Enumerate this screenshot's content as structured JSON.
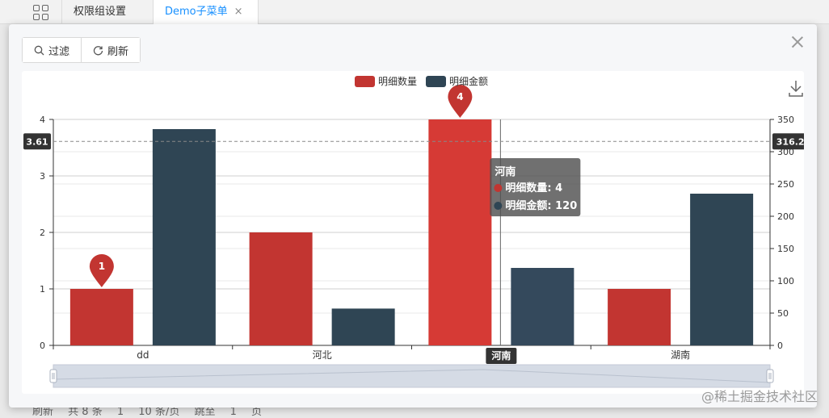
{
  "tabs": [
    {
      "label": "权限组设置"
    },
    {
      "label": "Demo子菜单",
      "close": "×"
    }
  ],
  "toolbar": {
    "filter_label": "过滤",
    "refresh_label": "刷新"
  },
  "background_footer": {
    "refresh": "刷新",
    "total": "共 8 条",
    "page": "1",
    "page_size": "10 条/页",
    "jump": "跳至",
    "jump_value": "1",
    "page_unit": "页"
  },
  "watermark": "@稀土掘金技术社区",
  "colors": {
    "series1": "#c23531",
    "series1_highlight": "#d63a35",
    "series2": "#2f4554",
    "series2_highlight": "#34495c",
    "tooltip_bg": "rgba(80,80,80,0.82)"
  },
  "chart_data": {
    "type": "bar",
    "categories": [
      "dd",
      "河北",
      "河南",
      "湖南"
    ],
    "series": [
      {
        "name": "明细数量",
        "axis": "left",
        "values": [
          1,
          2,
          4,
          1
        ]
      },
      {
        "name": "明细金额",
        "axis": "right",
        "values": [
          335,
          57,
          120,
          235
        ]
      }
    ],
    "y_left": {
      "ticks": [
        0,
        1,
        2,
        3,
        4
      ],
      "range": [
        0,
        4
      ]
    },
    "y_right": {
      "ticks": [
        0,
        50,
        100,
        150,
        200,
        250,
        300,
        350
      ],
      "range": [
        0,
        350
      ]
    },
    "legend_position": "top-center",
    "grid": true,
    "mark_points": [
      {
        "category": "dd",
        "series": "明细数量",
        "label": "1"
      },
      {
        "category": "河南",
        "series": "明细数量",
        "label": "4"
      }
    ],
    "axis_pointer": {
      "category": "河南",
      "left_value": "3.61",
      "right_value": "316.25"
    },
    "tooltip": {
      "title": "河南",
      "rows": [
        {
          "series": "明细数量",
          "value": "4"
        },
        {
          "series": "明细金额",
          "value": "120"
        }
      ]
    },
    "data_zoom": true,
    "toolbox": [
      "save-as-image"
    ]
  }
}
